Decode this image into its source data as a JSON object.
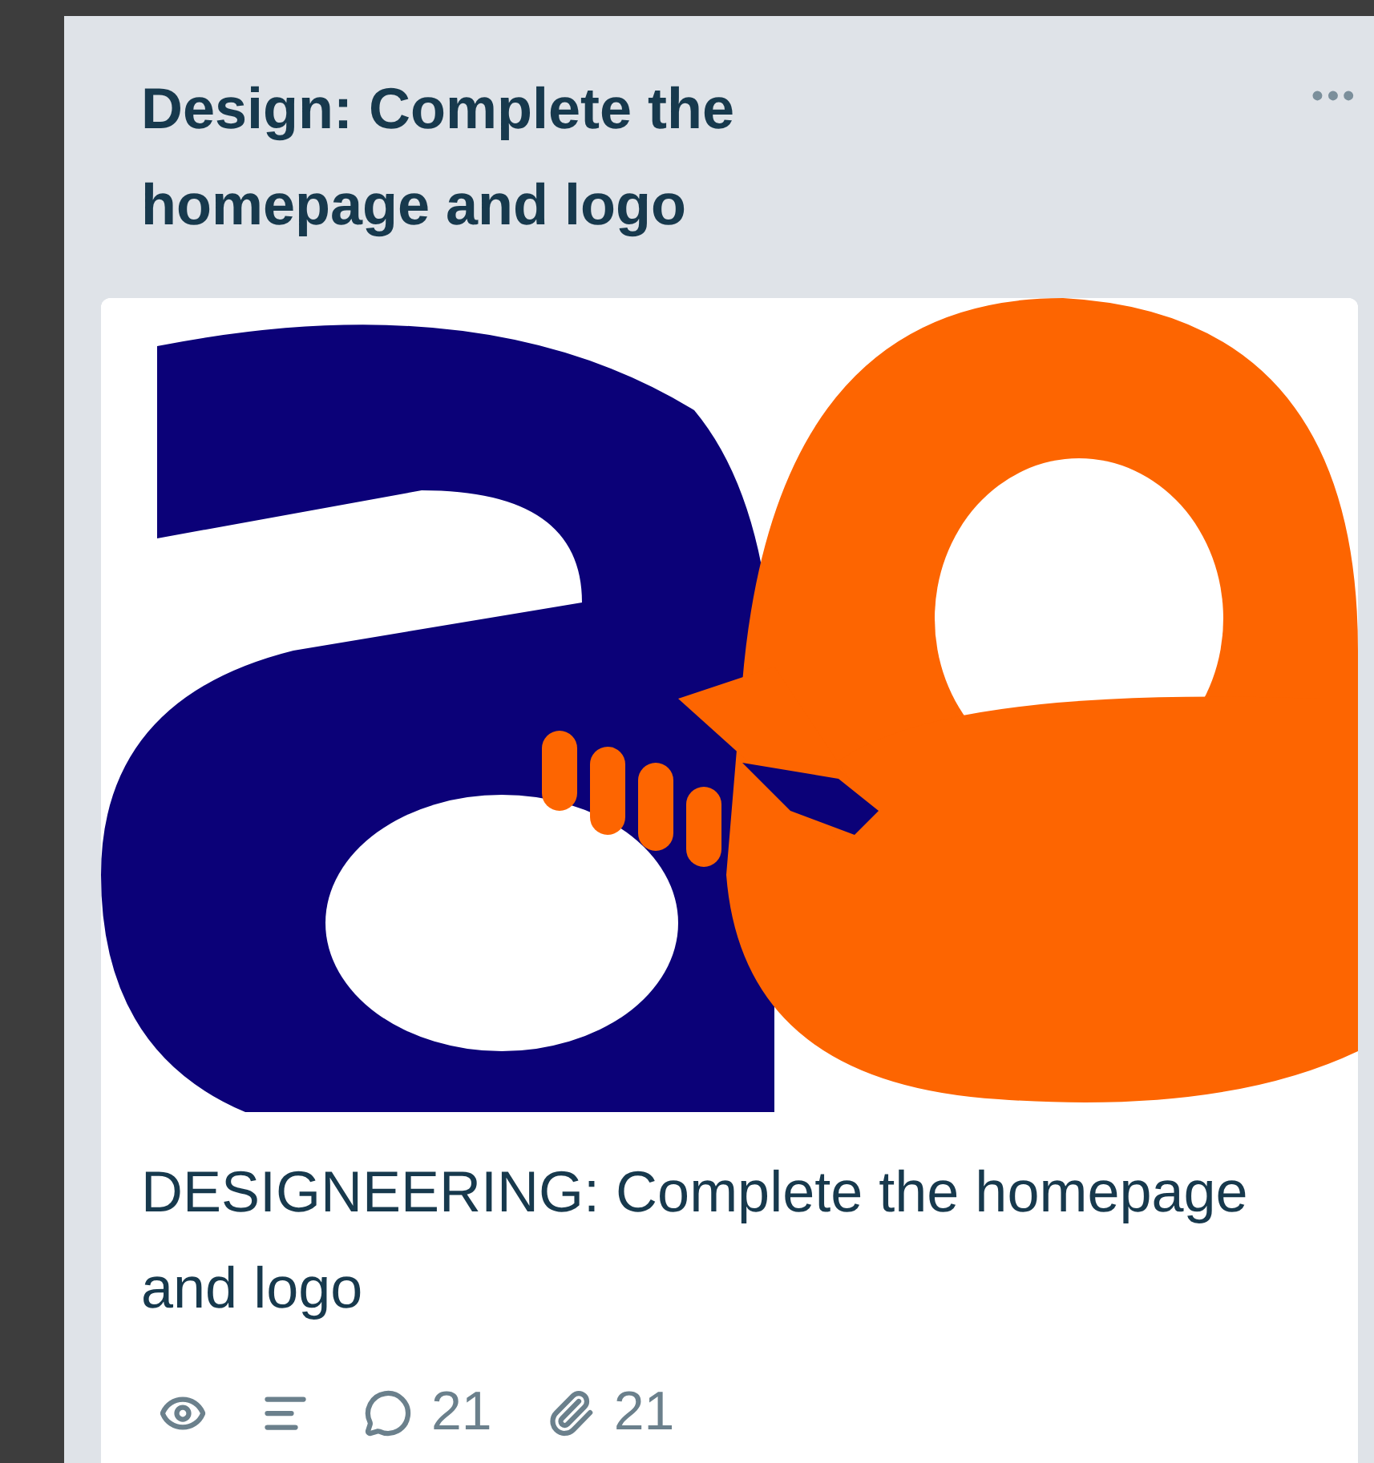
{
  "list": {
    "title": "Design: Complete the homepage and logo",
    "menu": "•••"
  },
  "card": {
    "title": "DESIGNEERING: Complete the homepage and logo",
    "badges": [
      {
        "kind": "watch"
      },
      {
        "kind": "description"
      },
      {
        "kind": "comments",
        "count": "21"
      },
      {
        "kind": "attachments",
        "count": "21"
      }
    ]
  }
}
